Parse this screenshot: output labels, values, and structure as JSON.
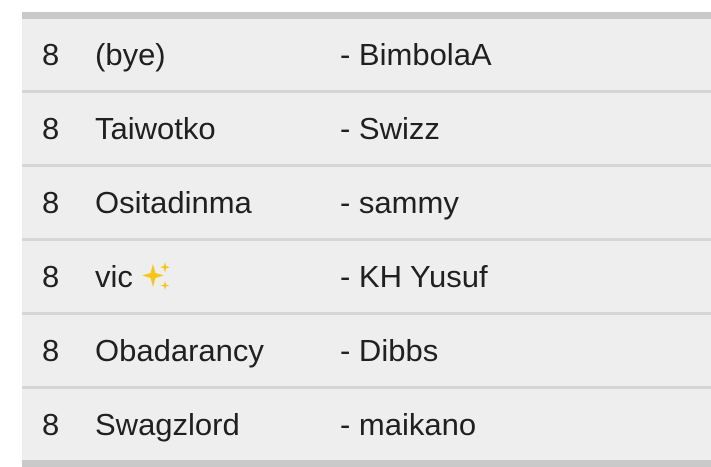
{
  "rows": [
    {
      "number": "8",
      "name": "(bye)",
      "partner": "- BimbolaA"
    },
    {
      "number": "8",
      "name": "Taiwotko",
      "partner": "- Swizz"
    },
    {
      "number": "8",
      "name": "Ositadinma",
      "partner": "- sammy"
    },
    {
      "number": "8",
      "name": "vic",
      "name_icon": "sparkles-icon",
      "partner": "- KH Yusuf"
    },
    {
      "number": "8",
      "name": "Obadarancy",
      "partner": "- Dibbs"
    },
    {
      "number": "8",
      "name": "Swagzlord",
      "partner": "- maikano"
    }
  ],
  "colors": {
    "row_background": "#eeeeee",
    "divider": "#d6d6d6",
    "frame": "#c9c9c9",
    "text": "#202020",
    "sparkle": "#f5c518"
  }
}
